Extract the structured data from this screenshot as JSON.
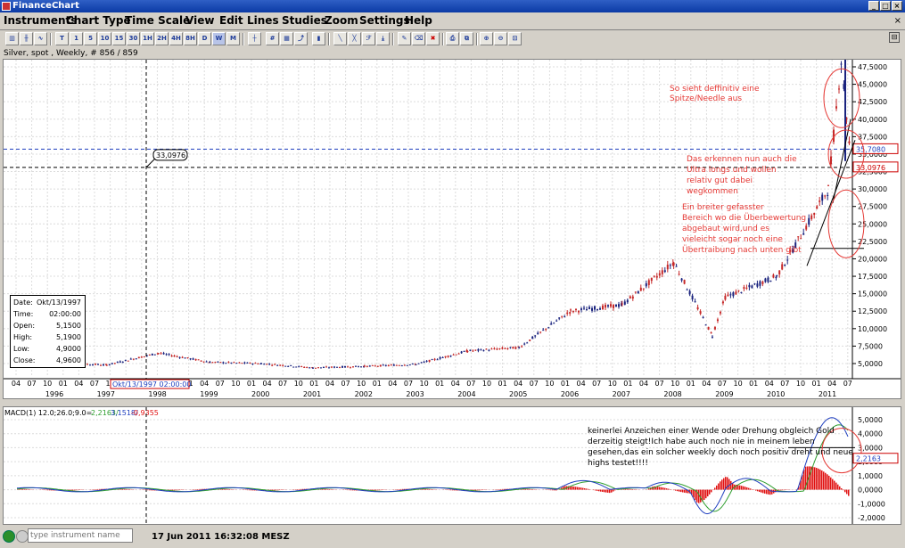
{
  "window": {
    "title": "FinanceChart",
    "minimize": "_",
    "maximize": "□",
    "close": "×"
  },
  "menu": [
    "Instruments",
    "Chart Type",
    "Time Scale",
    "View",
    "Edit",
    "Lines",
    "Studies",
    "Zoom",
    "Settings",
    "Help"
  ],
  "menu_close": "×",
  "toolbar": {
    "timeframe_buttons": [
      "T",
      "1",
      "5",
      "10",
      "15",
      "30",
      "1H",
      "2H",
      "4H",
      "8H",
      "D",
      "W",
      "M"
    ],
    "selected_timeframe": "W"
  },
  "chart_header": "Silver, spot , Weekly, # 856 / 859",
  "main_chart": {
    "price_axis": [
      "47,5000",
      "45,0000",
      "42,5000",
      "40,0000",
      "37,5000",
      "35,0000",
      "32,5000",
      "30,0000",
      "27,5000",
      "25,0000",
      "22,5000",
      "20,0000",
      "17,5000",
      "15,0000",
      "12,5000",
      "10,0000",
      "7,5000",
      "5,0000"
    ],
    "ylim": [
      3.0,
      50.0
    ],
    "price_labels": [
      "35,7080",
      "33,0976"
    ],
    "crosshair_label": "33,0976",
    "month_ticks": [
      "04",
      "07",
      "10",
      "01",
      "04",
      "07",
      "10",
      "01",
      "04",
      "07",
      "10",
      "01",
      "04",
      "07",
      "10",
      "01",
      "04",
      "07",
      "10",
      "01",
      "04",
      "07",
      "10",
      "01",
      "04",
      "07",
      "10",
      "01",
      "04",
      "07",
      "10",
      "01",
      "04",
      "07",
      "10",
      "01",
      "04",
      "07",
      "10",
      "01",
      "04",
      "07",
      "10",
      "01",
      "04",
      "07",
      "10",
      "01",
      "04",
      "07",
      "10",
      "01",
      "04",
      "07"
    ],
    "year_ticks": [
      "1996",
      "1997",
      "1998",
      "1999",
      "2000",
      "2001",
      "2002",
      "2003",
      "2004",
      "2005",
      "2006",
      "2007",
      "2008",
      "2009",
      "2010",
      "2011"
    ],
    "cursor_date": "Okt/13/1997 02:00:00",
    "annotations": [
      "So sieht deffinitiv eine Spitze/Needle aus",
      "Das erkennen nun auch die Ultra longs und wollen relativ gut dabei wegkommen",
      "Ein breiter gefasster Bereich wo die Überbewertung abgebaut wird,und es vieleicht sogar noch eine Übertraibung nach unten gibt"
    ]
  },
  "info_box": {
    "rows": [
      {
        "label": "Date:",
        "value": "Okt/13/1997"
      },
      {
        "label": "Time:",
        "value": "02:00:00"
      },
      {
        "label": "Open:",
        "value": "5,1500"
      },
      {
        "label": "High:",
        "value": "5,1900"
      },
      {
        "label": "Low:",
        "value": "4,9000"
      },
      {
        "label": "Close:",
        "value": "4,9600"
      }
    ]
  },
  "macd": {
    "header_name": "MACD(1) 12.0;26.0;9.0=",
    "header_v1": "2,2163",
    "header_v2": "3,1518",
    "header_v3": "-0,9355",
    "axis": [
      "5,0000",
      "4,0000",
      "3,0000",
      "2,0000",
      "1,0000",
      "0,0000",
      "-1,0000",
      "-2,0000"
    ],
    "value_label": "2,2163",
    "annotation": "keinerlei Anzeichen einer Wende oder Drehung obgleich Gold derzeitig steigt!Ich habe auch noch nie in meinem leben gesehen,das ein solcher weekly doch noch positiv dreht und neue highs testet!!!!"
  },
  "chart_data": {
    "type": "candlestick",
    "x_start": "1996",
    "x_end": "2011",
    "key_points": [
      {
        "date": "1996",
        "close": 5.1
      },
      {
        "date": "1997",
        "close": 4.8
      },
      {
        "date": "Okt/13/1997",
        "open": 5.15,
        "high": 5.19,
        "low": 4.9,
        "close": 4.96
      },
      {
        "date": "1998",
        "close": 6.5
      },
      {
        "date": "1999",
        "close": 5.2
      },
      {
        "date": "2000",
        "close": 5.0
      },
      {
        "date": "2001",
        "close": 4.4
      },
      {
        "date": "2002",
        "close": 4.6
      },
      {
        "date": "2003",
        "close": 4.9
      },
      {
        "date": "2004",
        "close": 6.8
      },
      {
        "date": "2005",
        "close": 7.3
      },
      {
        "date": "2006",
        "close": 12.5
      },
      {
        "date": "2007",
        "close": 13.4
      },
      {
        "date": "2008",
        "close": 19.5
      },
      {
        "date": "2008-10",
        "close": 9.0
      },
      {
        "date": "2009",
        "close": 14.5
      },
      {
        "date": "2010",
        "close": 17.5
      },
      {
        "date": "2011",
        "close": 30.0
      },
      {
        "date": "2011-04",
        "close": 48.5
      },
      {
        "date": "2011-06",
        "close": 35.7
      }
    ],
    "series_color_up": "#1a237e",
    "series_color_down": "#c62828",
    "macd_line_color": "#1f3fbf",
    "signal_line_color": "#2e9e2e",
    "histogram_color": "#e01010"
  }
}
